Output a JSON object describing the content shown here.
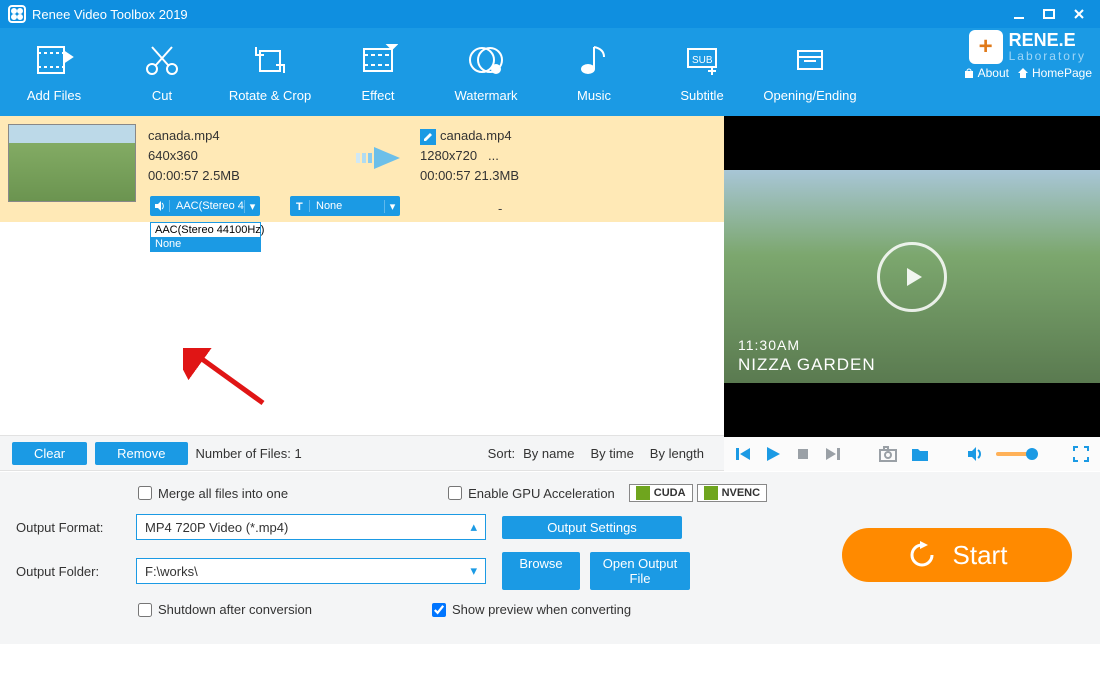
{
  "titlebar": {
    "title": "Renee Video Toolbox 2019"
  },
  "brand": {
    "name": "RENE.E",
    "sub": "Laboratory",
    "about": "About",
    "home": "HomePage"
  },
  "toolbar": [
    {
      "id": "add-files",
      "label": "Add Files"
    },
    {
      "id": "cut",
      "label": "Cut"
    },
    {
      "id": "rotate-crop",
      "label": "Rotate & Crop"
    },
    {
      "id": "effect",
      "label": "Effect"
    },
    {
      "id": "watermark",
      "label": "Watermark"
    },
    {
      "id": "music",
      "label": "Music"
    },
    {
      "id": "subtitle",
      "label": "Subtitle"
    },
    {
      "id": "opening-ending",
      "label": "Opening/Ending"
    }
  ],
  "file": {
    "src": {
      "name": "canada.mp4",
      "res": "640x360",
      "dur": "00:00:57",
      "size": "2.5MB"
    },
    "dst": {
      "name": "canada.mp4",
      "res": "1280x720",
      "extra": "...",
      "dur": "00:00:57",
      "size": "21.3MB"
    },
    "audio_pill": "AAC(Stereo 4",
    "sub_pill": "None",
    "dash": "-"
  },
  "dropdown": {
    "opt0": "AAC(Stereo 44100Hz)",
    "opt1": "None"
  },
  "sortbar": {
    "clear": "Clear",
    "remove": "Remove",
    "count_label": "Number of Files:",
    "count": "1",
    "sort_label": "Sort:",
    "by_name": "By name",
    "by_time": "By time",
    "by_length": "By length"
  },
  "preview": {
    "overlay_time": "11:30AM",
    "overlay_place": "NIZZA GARDEN"
  },
  "footer": {
    "merge": "Merge all files into one",
    "gpu": "Enable GPU Acceleration",
    "cuda": "CUDA",
    "nvenc": "NVENC",
    "format_label": "Output Format:",
    "format_value": "MP4 720P Video (*.mp4)",
    "output_settings": "Output Settings",
    "folder_label": "Output Folder:",
    "folder_value": "F:\\works\\",
    "browse": "Browse",
    "open_folder": "Open Output File",
    "shutdown": "Shutdown after conversion",
    "show_preview": "Show preview when converting",
    "start": "Start"
  }
}
